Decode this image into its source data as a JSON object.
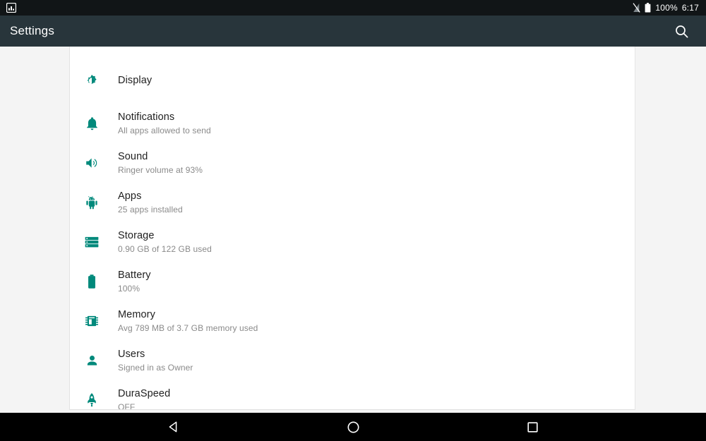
{
  "status_bar": {
    "notification_icon": "screenshot-image-icon",
    "signal_icon": "signal-off-icon",
    "battery_icon": "battery-full-icon",
    "battery_level": "100%",
    "clock": "6:17"
  },
  "app_bar": {
    "title": "Settings",
    "search_icon": "search-icon"
  },
  "theme": {
    "accent": "#00897b",
    "app_bar_bg": "#28353b",
    "status_bar_bg": "#111517",
    "page_bg": "#f4f4f4",
    "card_bg": "#ffffff",
    "title_color": "#1f1f1f",
    "subtitle_color": "#8a8a8a",
    "nav_bar_bg": "#000000"
  },
  "settings": {
    "items": [
      {
        "icon": "brightness-icon",
        "title": "Display",
        "subtitle": ""
      },
      {
        "icon": "bell-icon",
        "title": "Notifications",
        "subtitle": "All apps allowed to send"
      },
      {
        "icon": "volume-icon",
        "title": "Sound",
        "subtitle": "Ringer volume at 93%"
      },
      {
        "icon": "android-icon",
        "title": "Apps",
        "subtitle": "25 apps installed"
      },
      {
        "icon": "storage-icon",
        "title": "Storage",
        "subtitle": "0.90 GB of 122 GB used"
      },
      {
        "icon": "battery-icon",
        "title": "Battery",
        "subtitle": "100%"
      },
      {
        "icon": "memory-chip-icon",
        "title": "Memory",
        "subtitle": "Avg 789 MB of 3.7 GB memory used"
      },
      {
        "icon": "person-icon",
        "title": "Users",
        "subtitle": "Signed in as Owner"
      },
      {
        "icon": "rocket-icon",
        "title": "DuraSpeed",
        "subtitle": "OFF"
      }
    ]
  },
  "nav_bar": {
    "back_icon": "back-triangle-icon",
    "home_icon": "home-circle-icon",
    "recents_icon": "recents-square-icon"
  }
}
